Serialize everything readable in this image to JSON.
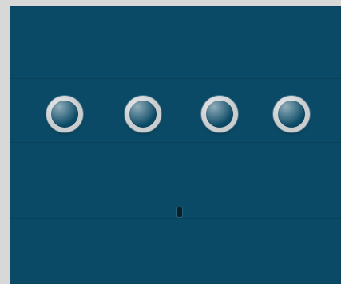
{
  "screen": {
    "background_color": "#d8d8d8",
    "panel_color": "#0b4a66",
    "pin_ring_color": "#c9cdd0"
  },
  "pin_entry": {
    "slots": [
      {
        "state": "empty"
      },
      {
        "state": "empty"
      },
      {
        "state": "empty"
      },
      {
        "state": "empty"
      }
    ]
  }
}
